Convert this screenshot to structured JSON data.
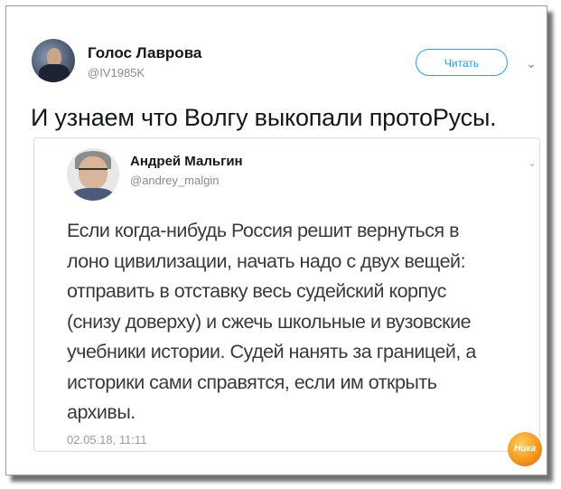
{
  "tweet": {
    "author_name": "Голос Лаврова",
    "author_handle": "@IV1985K",
    "follow_label": "Читать",
    "text": "И узнаем что Волгу выкопали протоРусы."
  },
  "quoted": {
    "author_name": "Андрей Мальгин",
    "author_handle": "@andrey_malgin",
    "lines": [
      "Если когда-нибудь Россия решит вернуться в",
      "лоно цивилизации, начать надо с двух вещей:",
      "отправить в отставку весь судейский корпус",
      "(снизу доверху) и сжечь школьные и вузовские",
      "учебники истории. Судей нанять за границей, а",
      "историки сами справятся, если им открыть",
      "архивы."
    ],
    "timestamp": "02.05.18, 11:11"
  },
  "watermark": {
    "text": "Ника"
  },
  "colors": {
    "accent": "#1da1f2",
    "text": "#14171a",
    "muted": "#8a8a8a"
  },
  "icons": {
    "menu": "chevron-down-icon"
  }
}
